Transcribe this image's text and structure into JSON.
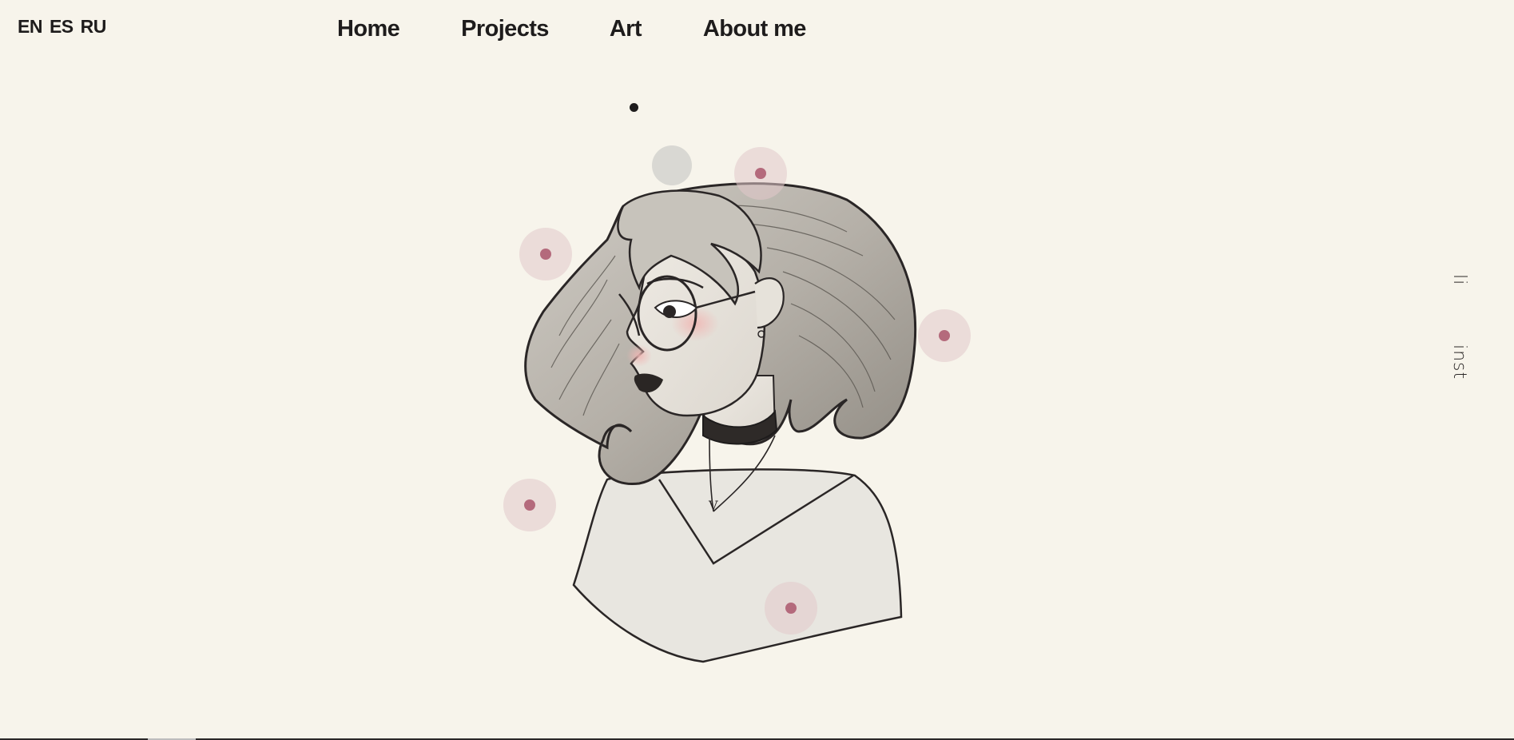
{
  "languages": [
    "EN",
    "ES",
    "RU"
  ],
  "nav": {
    "home": "Home",
    "projects": "Projects",
    "art": "Art",
    "about": "About me"
  },
  "social": {
    "linkedin": "li",
    "instagram": "inst"
  },
  "illustration": {
    "subject": "pencil sketch portrait of a girl with wavy hair, glasses and choker",
    "pendant_letter": "V"
  },
  "colors": {
    "background": "#f7f4eb",
    "text": "#1e1c1c",
    "hotspot_ring": "#e2c8ca",
    "hotspot_core": "#b46a7c",
    "blush": "#f0b7b4"
  }
}
